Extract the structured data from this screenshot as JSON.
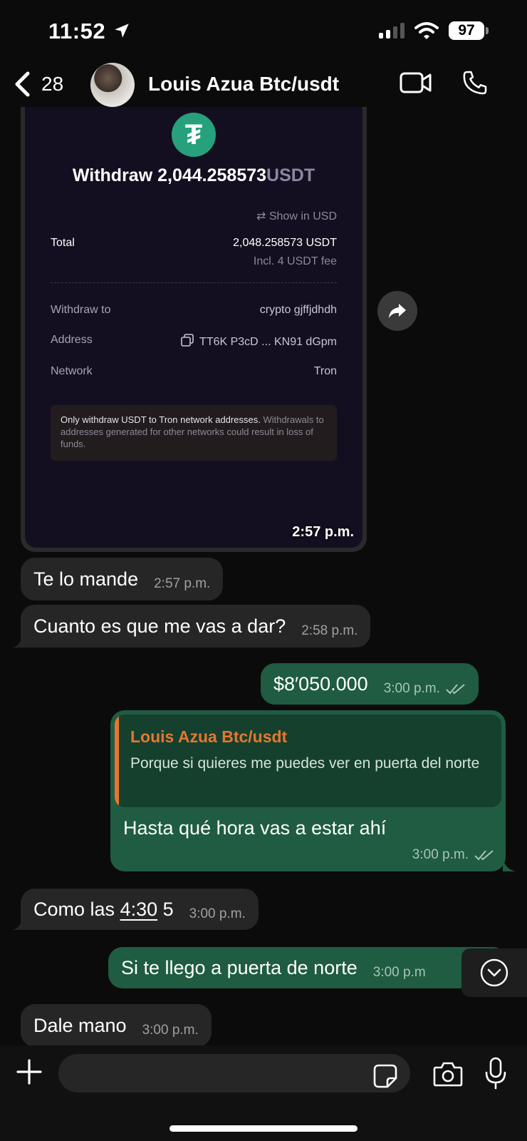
{
  "status_bar": {
    "time": "11:52",
    "battery": "97"
  },
  "header": {
    "back_count": "28",
    "contact_name": "Louis Azua Btc/usdt"
  },
  "withdraw_card": {
    "title_amount": "Withdraw 2,044.258573",
    "title_currency": "USDT",
    "show_in_usd": "Show in USD",
    "total_label": "Total",
    "total_value": "2,048.258573 USDT",
    "fee": "Incl. 4 USDT fee",
    "withdraw_to_label": "Withdraw to",
    "withdraw_to_value": "crypto gjffjdhdh",
    "address_label": "Address",
    "address_value": "TT6K P3cD ... KN91 dGpm",
    "network_label": "Network",
    "network_value": "Tron",
    "warning_bold": "Only withdraw USDT to Tron network addresses.",
    "warning_rest": " Withdrawals to addresses generated for other networks could result in loss of funds.",
    "time": "2:57 p.m."
  },
  "messages": [
    {
      "text": "Te lo mande",
      "time": "2:57 p.m."
    },
    {
      "text": "Cuanto es que me vas a dar?",
      "time": "2:58 p.m."
    },
    {
      "text": "$8′050.000",
      "time": "3:00 p.m."
    },
    {
      "text": "Hasta qué hora vas a estar ahí",
      "time": "3:00 p.m.",
      "quote_name": "Louis Azua Btc/usdt",
      "quote_text": "Porque si quieres me puedes ver en puerta del norte"
    },
    {
      "text_before": "Como las ",
      "text_link": "4:30",
      "text_after": " 5",
      "time": "3:00 p.m."
    },
    {
      "text": "Si te llego a puerta de norte",
      "time": "3:00 p.m"
    },
    {
      "text": "Dale mano",
      "time": "3:00 p.m."
    }
  ],
  "colors": {
    "outgoing": "#1f5c42",
    "incoming": "#262626",
    "quote_accent": "#e6772f",
    "tether": "#26a17b"
  }
}
